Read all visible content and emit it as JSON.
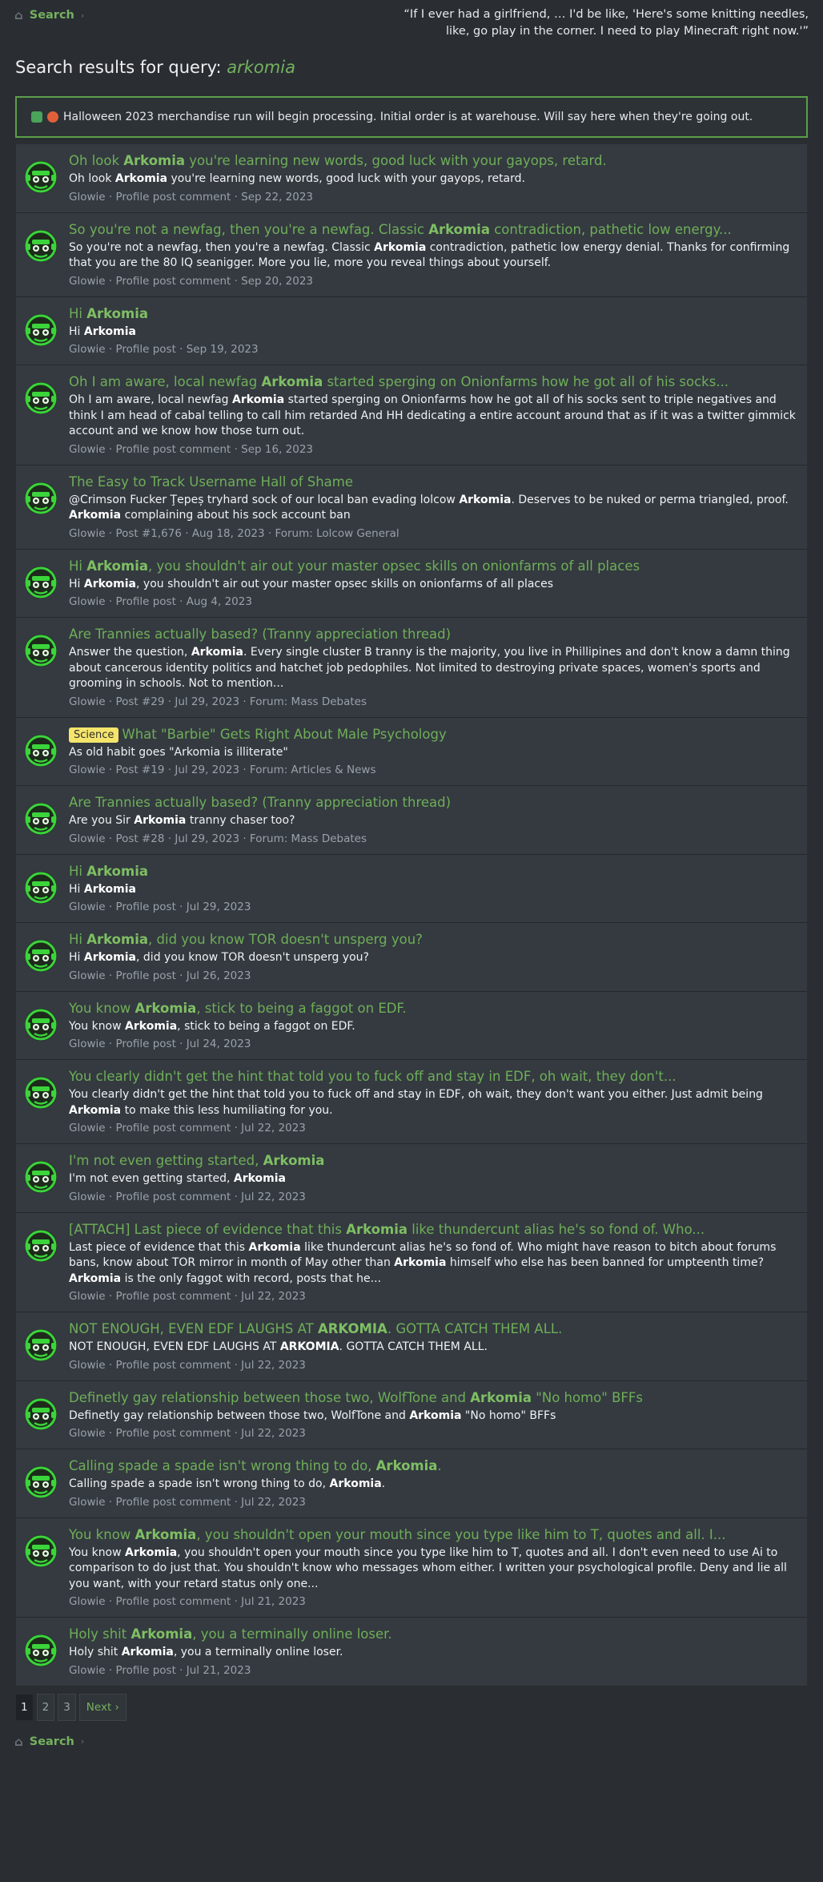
{
  "breadcrumb": {
    "label": "Search"
  },
  "quote": "“If I ever had a girlfriend, … I'd be like, 'Here's some knitting needles, like, go play in the corner. I need to play Minecraft right now.'”",
  "page_title": {
    "prefix": "Search results for query:",
    "query": "arkomia"
  },
  "notice": {
    "text": "Halloween 2023 merchandise run will begin processing. Initial order is at warehouse. Will say here when they're going out."
  },
  "colors": {
    "accent": "#6fae58",
    "notice_border": "#5c9e4a",
    "prefix_bg": "#f5e56b"
  },
  "results": [
    {
      "title": "Oh look <b>Arkomia</b> you're learning new words, good luck with your gayops, retard.",
      "snippet": "Oh look <b>Arkomia</b> you're learning new words, good luck with your gayops, retard.",
      "meta": "Glowie · Profile post comment · Sep 22, 2023"
    },
    {
      "title": "So you're not a newfag, then you're a newfag. Classic <b>Arkomia</b> contradiction, pathetic low energy...",
      "snippet": "So you're not a newfag, then you're a newfag. Classic <b>Arkomia</b> contradiction, pathetic low energy denial. Thanks for confirming that you are the 80 IQ seanigger. More you lie, more you reveal things about yourself.",
      "meta": "Glowie · Profile post comment · Sep 20, 2023"
    },
    {
      "title": "Hi <b>Arkomia</b>",
      "snippet": "Hi <b>Arkomia</b>",
      "meta": "Glowie · Profile post · Sep 19, 2023"
    },
    {
      "title": "Oh I am aware, local newfag <b>Arkomia</b> started sperging on Onionfarms how he got all of his socks...",
      "snippet": "Oh I am aware, local newfag <b>Arkomia</b> started sperging on Onionfarms how he got all of his socks sent to triple negatives and think I am head of cabal telling to call him retarded And HH dedicating a entire account around that as if it was a twitter gimmick account and we know how those turn out.",
      "meta": "Glowie · Profile post comment · Sep 16, 2023"
    },
    {
      "title": "The Easy to Track Username Hall of Shame",
      "snippet": "@Crimson Fucker Ţepeș tryhard sock of our local ban evading lolcow <b>Arkomia</b>. Deserves to be nuked or perma triangled, proof. <b>Arkomia</b> complaining about his sock account ban",
      "meta": "Glowie · Post #1,676 · Aug 18, 2023 · Forum: Lolcow General"
    },
    {
      "title": "Hi <b>Arkomia</b>, you shouldn't air out your master opsec skills on onionfarms of all places",
      "snippet": "Hi <b>Arkomia</b>, you shouldn't air out your master opsec skills on onionfarms of all places",
      "meta": "Glowie · Profile post · Aug 4, 2023"
    },
    {
      "title": "Are Trannies actually based? (Tranny appreciation thread)",
      "snippet": "Answer the question, <b>Arkomia</b>. Every single cluster B tranny is the majority, you live in Phillipines and don't know a damn thing about cancerous identity politics and hatchet job pedophiles. Not limited to destroying private spaces, women's sports and grooming in schools. Not to mention...",
      "meta": "Glowie · Post #29 · Jul 29, 2023 · Forum: Mass Debates"
    },
    {
      "prefix": "Science",
      "title": "What \"Barbie\" Gets Right About Male Psychology",
      "snippet": "As old habit goes \"Arkomia is illiterate\"",
      "meta": "Glowie · Post #19 · Jul 29, 2023 · Forum: Articles &amp; News"
    },
    {
      "title": "Are Trannies actually based? (Tranny appreciation thread)",
      "snippet": "Are you Sir <b>Arkomia</b> tranny chaser too?",
      "meta": "Glowie · Post #28 · Jul 29, 2023 · Forum: Mass Debates"
    },
    {
      "title": "Hi <b>Arkomia</b>",
      "snippet": "Hi <b>Arkomia</b>",
      "meta": "Glowie · Profile post · Jul 29, 2023"
    },
    {
      "title": "Hi <b>Arkomia</b>, did you know TOR doesn't unsperg you?",
      "snippet": "Hi <b>Arkomia</b>, did you know TOR doesn't unsperg you?",
      "meta": "Glowie · Profile post · Jul 26, 2023"
    },
    {
      "title": "You know <b>Arkomia</b>, stick to being a faggot on EDF.",
      "snippet": "You know <b>Arkomia</b>, stick to being a faggot on EDF.",
      "meta": "Glowie · Profile post · Jul 24, 2023"
    },
    {
      "title": "You clearly didn't get the hint that told you to fuck off and stay in EDF, oh wait, they don't...",
      "snippet": "You clearly didn't get the hint that told you to fuck off and stay in EDF, oh wait, they don't want you either. Just admit being <b>Arkomia</b> to make this less humiliating for you.",
      "meta": "Glowie · Profile post comment · Jul 22, 2023"
    },
    {
      "title": "I'm not even getting started, <b>Arkomia</b>",
      "snippet": "I'm not even getting started, <b>Arkomia</b>",
      "meta": "Glowie · Profile post comment · Jul 22, 2023"
    },
    {
      "title": "[ATTACH] Last piece of evidence that this <b>Arkomia</b> like thundercunt alias he's so fond of. Who...",
      "snippet": "Last piece of evidence that this <b>Arkomia</b> like thundercunt alias he's so fond of. Who might have reason to bitch about forums bans, know about TOR mirror in month of May other than <b>Arkomia</b> himself who else has been banned for umpteenth time? <b>Arkomia</b> is the only faggot with record, posts that he...",
      "meta": "Glowie · Profile post comment · Jul 22, 2023"
    },
    {
      "title": "NOT ENOUGH, EVEN EDF LAUGHS AT <b>ARKOMIA</b>. GOTTA CATCH THEM ALL.",
      "snippet": "NOT ENOUGH, EVEN EDF LAUGHS AT <b>ARKOMIA</b>. GOTTA CATCH THEM ALL.",
      "meta": "Glowie · Profile post comment · Jul 22, 2023"
    },
    {
      "title": "Definetly gay relationship between those two, WolfTone and <b>Arkomia</b> \"No homo\" BFFs",
      "snippet": "Definetly gay relationship between those two, WolfTone and <b>Arkomia</b> \"No homo\" BFFs",
      "meta": "Glowie · Profile post comment · Jul 22, 2023"
    },
    {
      "title": "Calling spade a spade isn't wrong thing to do, <b>Arkomia</b>.",
      "snippet": "Calling spade a spade isn't wrong thing to do, <b>Arkomia</b>.",
      "meta": "Glowie · Profile post comment · Jul 22, 2023"
    },
    {
      "title": "You know <b>Arkomia</b>, you shouldn't open your mouth since you type like him to T, quotes and all. I...",
      "snippet": "You know <b>Arkomia</b>, you shouldn't open your mouth since you type like him to T, quotes and all. I don't even need to use Ai to comparison to do just that. You shouldn't know who messages whom either. I written your psychological profile. Deny and lie all you want, with your retard status only one...",
      "meta": "Glowie · Profile post comment · Jul 21, 2023"
    },
    {
      "title": "Holy shit <b>Arkomia</b>, you a terminally online loser.",
      "snippet": "Holy shit <b>Arkomia</b>, you a terminally online loser.",
      "meta": "Glowie · Profile post · Jul 21, 2023"
    }
  ],
  "pagination": {
    "pages": [
      "1",
      "2",
      "3"
    ],
    "current": "1",
    "next_label": "Next ›"
  }
}
